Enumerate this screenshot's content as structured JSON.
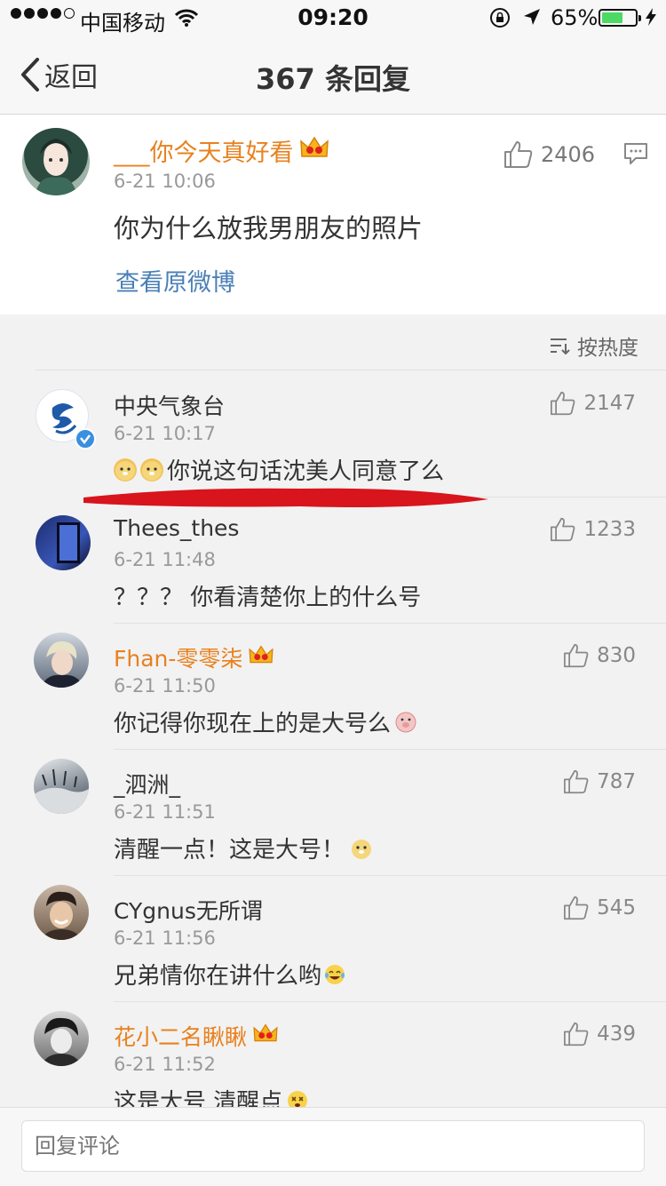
{
  "status_bar": {
    "carrier": "中国移动",
    "time": "09:20",
    "battery_percent": "65%",
    "battery_level": 0.65,
    "signal_bars": 4
  },
  "nav": {
    "back_label": "返回",
    "title": "367 条回复"
  },
  "original_comment": {
    "username": "___你今天真好看",
    "time": "6-21 10:06",
    "text": "你为什么放我男朋友的照片",
    "likes": "2406",
    "view_original_label": "查看原微博"
  },
  "sort": {
    "label": "按热度"
  },
  "comments": [
    {
      "username": "中央气象台",
      "time": "6-21 10:17",
      "text": "你说这句话沈美人同意了么",
      "likes": "2147",
      "emoji_count": 2,
      "verified": true,
      "vip": false
    },
    {
      "username": "Thees_thes",
      "time": "6-21 11:48",
      "text": "？？？ 你看清楚你上的什么号",
      "likes": "1233",
      "vip": false
    },
    {
      "username": "Fhan-零零柒",
      "time": "6-21 11:50",
      "text": "你记得你现在上的是大号么",
      "likes": "830",
      "vip": true
    },
    {
      "username": "_泗洲_",
      "time": "6-21 11:51",
      "text": "清醒一点！这是大号！",
      "likes": "787",
      "vip": false
    },
    {
      "username": "CYgnus无所谓",
      "time": "6-21 11:56",
      "text": "兄弟情你在讲什么哟",
      "likes": "545",
      "vip": false
    },
    {
      "username": "花小二名瞅瞅",
      "time": "6-21 11:52",
      "text": "这是大号 清醒点",
      "likes": "439",
      "vip": true
    }
  ],
  "reply_input": {
    "placeholder": "回复评论"
  },
  "colors": {
    "vip_name": "#e8811e",
    "link": "#4a7fb6",
    "highlight_stroke": "#d8141c",
    "battery_fill": "#4cd964"
  }
}
